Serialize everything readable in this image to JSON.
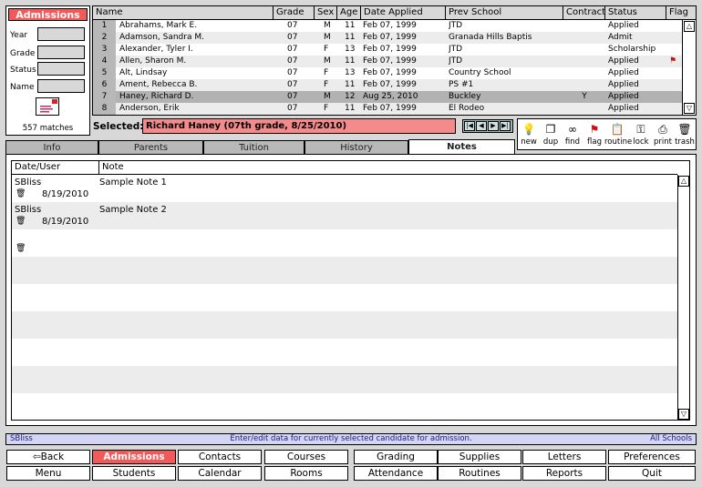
{
  "search": {
    "title": "Admissions",
    "fields": [
      "Year",
      "Grade",
      "Status",
      "Name"
    ],
    "match_count": "557 matches"
  },
  "table": {
    "columns": [
      "Name",
      "Grade",
      "Sex",
      "Age",
      "Date Applied",
      "Prev School",
      "Contract",
      "Status",
      "Flag"
    ],
    "rows": [
      {
        "n": "1",
        "name": "Abrahams, Mark E.",
        "grade": "07",
        "sex": "M",
        "age": "11",
        "date": "Feb 07, 1999",
        "school": "JTD",
        "contract": "",
        "status": "Applied",
        "flag": ""
      },
      {
        "n": "2",
        "name": "Adamson, Sandra M.",
        "grade": "07",
        "sex": "M",
        "age": "11",
        "date": "Feb 07, 1999",
        "school": "Granada Hills Baptis",
        "contract": "",
        "status": "Admit",
        "flag": ""
      },
      {
        "n": "3",
        "name": "Alexander, Tyler I.",
        "grade": "07",
        "sex": "F",
        "age": "13",
        "date": "Feb 07, 1999",
        "school": "JTD",
        "contract": "",
        "status": "Scholarship",
        "flag": ""
      },
      {
        "n": "4",
        "name": "Allen, Sharon M.",
        "grade": "07",
        "sex": "M",
        "age": "11",
        "date": "Feb 07, 1999",
        "school": "JTD",
        "contract": "",
        "status": "Applied",
        "flag": "flag"
      },
      {
        "n": "5",
        "name": "Alt, Lindsay",
        "grade": "07",
        "sex": "F",
        "age": "13",
        "date": "Feb 07, 1999",
        "school": "Country School",
        "contract": "",
        "status": "Applied",
        "flag": ""
      },
      {
        "n": "6",
        "name": "Ament, Rebecca B.",
        "grade": "07",
        "sex": "F",
        "age": "11",
        "date": "Feb 07, 1999",
        "school": "PS #1",
        "contract": "",
        "status": "Applied",
        "flag": ""
      },
      {
        "n": "7",
        "name": "Haney, Richard D.",
        "grade": "07",
        "sex": "M",
        "age": "12",
        "date": "Aug 25, 2010",
        "school": "Buckley",
        "contract": "Y",
        "status": "Applied",
        "flag": ""
      },
      {
        "n": "8",
        "name": "Anderson, Erik",
        "grade": "07",
        "sex": "F",
        "age": "11",
        "date": "Feb 07, 1999",
        "school": "El Rodeo",
        "contract": "",
        "status": "Applied",
        "flag": ""
      }
    ]
  },
  "selected": {
    "label": "Selected:",
    "value": "Richard Haney (07th grade, 8/25/2010)"
  },
  "toolbar": [
    "new",
    "dup",
    "find",
    "flag",
    "routine",
    "lock",
    "print",
    "trash"
  ],
  "tabs": [
    "Info",
    "Parents",
    "Tuition",
    "History",
    "Notes"
  ],
  "notes": {
    "columns": [
      "Date/User",
      "Note"
    ],
    "rows": [
      {
        "user": "SBliss",
        "date": "8/19/2010",
        "text": "Sample Note 1"
      },
      {
        "user": "SBliss",
        "date": "8/19/2010",
        "text": "Sample Note 2"
      }
    ]
  },
  "status_bar": {
    "user": "SBliss",
    "message": "Enter/edit data for currently selected candidate for admission.",
    "scope": "All Schools"
  },
  "nav": {
    "row1": [
      "Back",
      "Admissions",
      "Contacts",
      "Courses",
      "Grading",
      "Supplies",
      "Letters",
      "Preferences"
    ],
    "row2": [
      "Menu",
      "Students",
      "Calendar",
      "Rooms",
      "Attendance",
      "Routines",
      "Reports",
      "Quit"
    ]
  },
  "colors": {
    "accent": "#f05a5a",
    "selected_field": "#f48a8a",
    "status_bar": "#d4d4f4"
  }
}
